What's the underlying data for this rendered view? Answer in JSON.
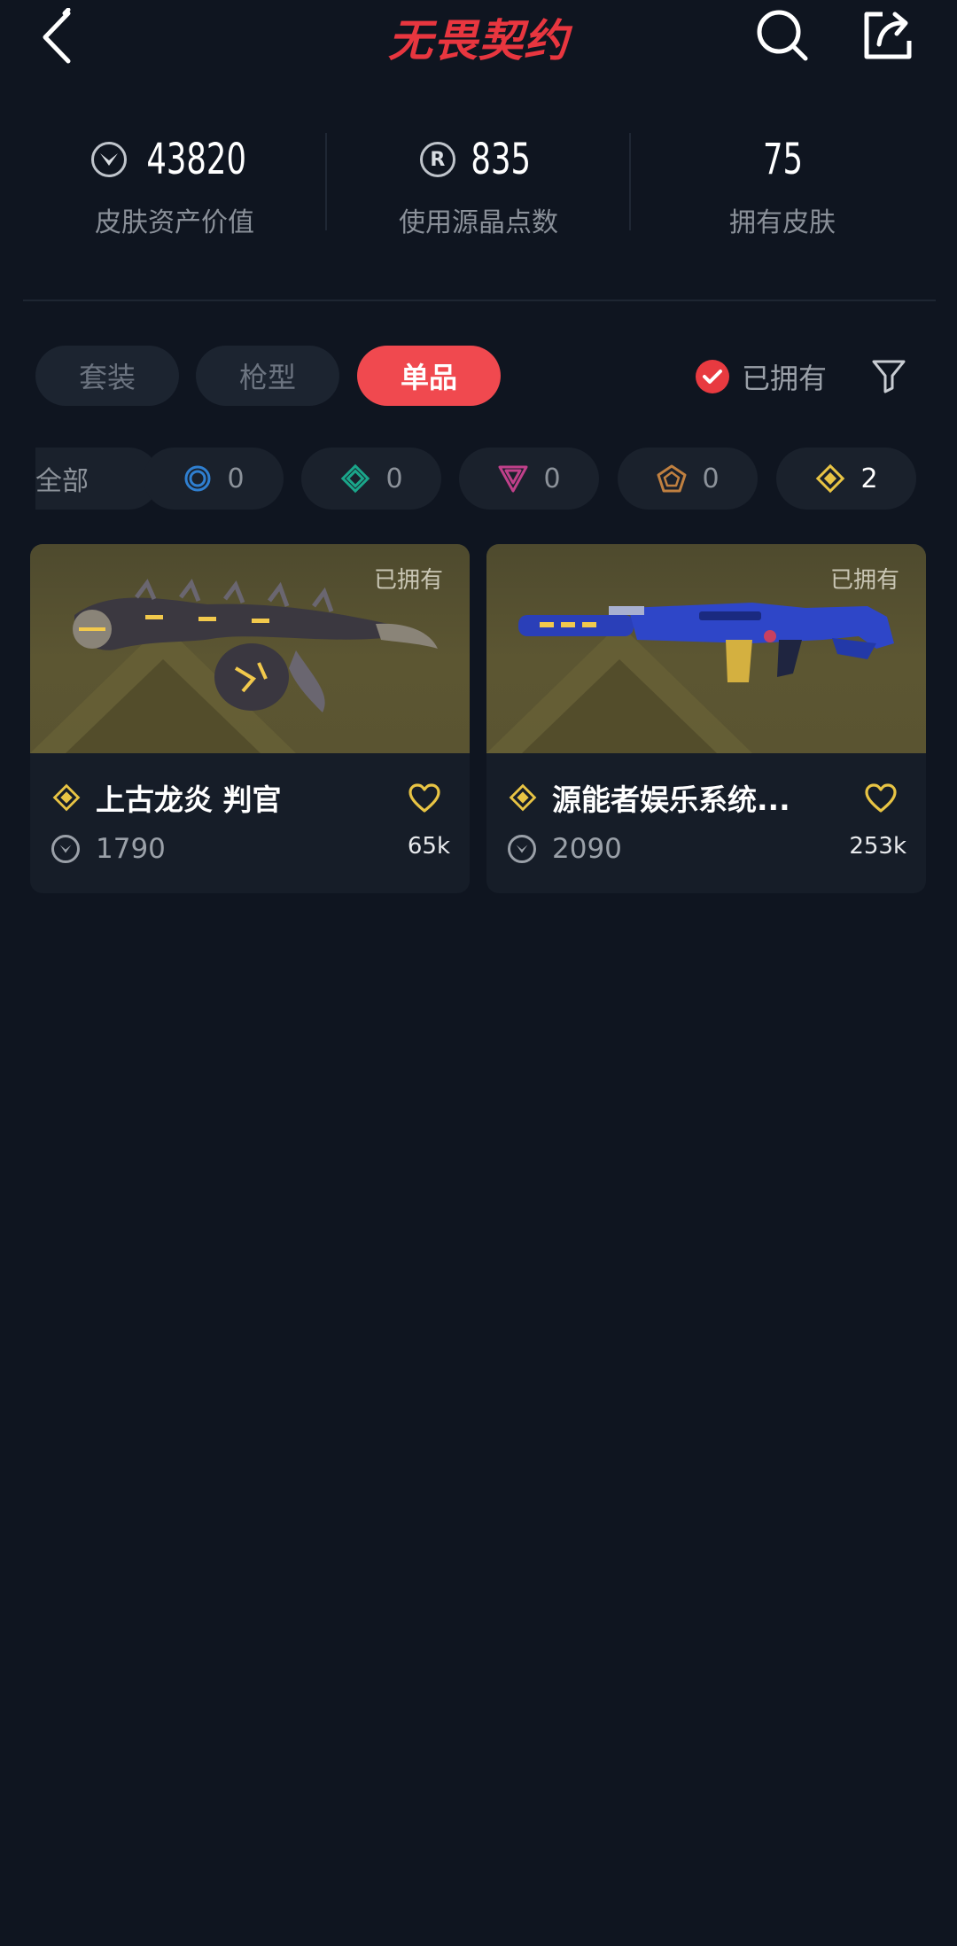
{
  "header": {
    "logo_text": "无畏契约",
    "icons": [
      "back-icon",
      "search-icon",
      "share-icon"
    ]
  },
  "stats": [
    {
      "value": "43820",
      "label": "皮肤资产价值",
      "icon": "valorant-point-icon"
    },
    {
      "value": "835",
      "label": "使用源晶点数",
      "icon": "radianite-icon",
      "icon_letter": "R"
    },
    {
      "value": "75",
      "label": "拥有皮肤"
    }
  ],
  "tabs": [
    {
      "label": "套装",
      "active": false
    },
    {
      "label": "枪型",
      "active": false
    },
    {
      "label": "单品",
      "active": true
    }
  ],
  "owned_filter": {
    "label": "已拥有",
    "checked": true
  },
  "tiers": [
    {
      "label": "全部"
    },
    {
      "icon": "select-tier-icon",
      "count": "0",
      "color": "#2f7fd0"
    },
    {
      "icon": "deluxe-tier-icon",
      "count": "0",
      "color": "#1aa68a"
    },
    {
      "icon": "premium-tier-icon",
      "count": "0",
      "color": "#c0408a"
    },
    {
      "icon": "ultra-tier-icon",
      "count": "0",
      "color": "#c08040"
    },
    {
      "icon": "exclusive-tier-icon",
      "count": "2",
      "color": "#e8c444",
      "selected": true
    }
  ],
  "cards": [
    {
      "name": "上古龙炎 判官",
      "price": "1790",
      "likes": "65k",
      "owned_tag": "已拥有",
      "tier": "exclusive"
    },
    {
      "name": "源能者娱乐系统...",
      "price": "2090",
      "likes": "253k",
      "owned_tag": "已拥有",
      "tier": "exclusive"
    }
  ],
  "colors": {
    "background": "#0f1520",
    "accent": "#f0494f",
    "exclusive_gold": "#e8c444"
  }
}
